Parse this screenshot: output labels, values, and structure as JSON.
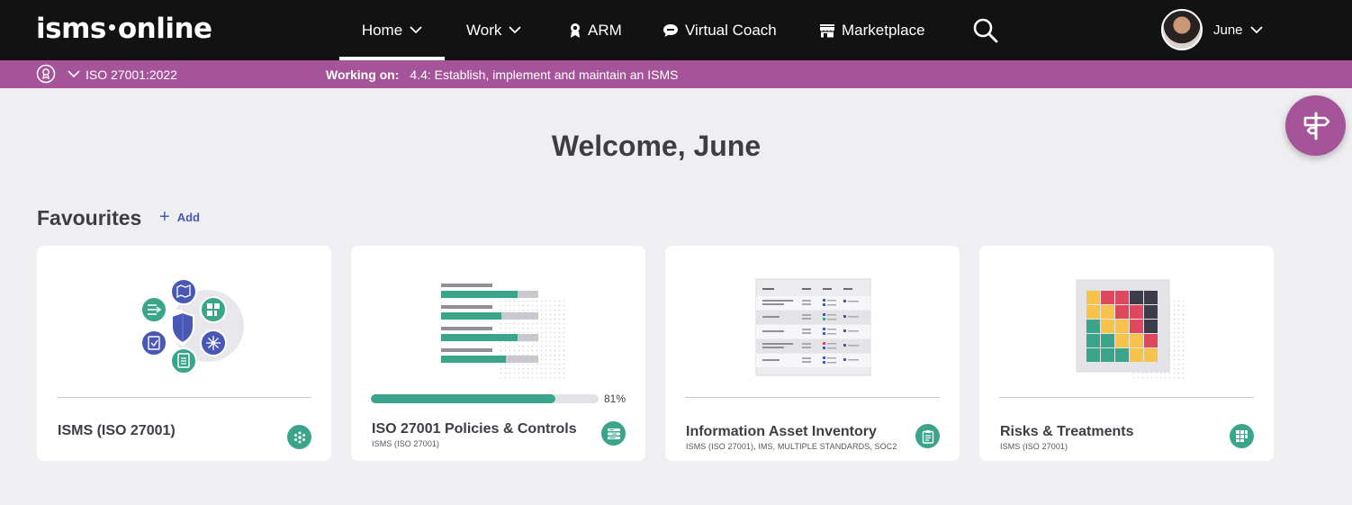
{
  "brand": {
    "logo_left": "isms",
    "logo_right": "online"
  },
  "nav": {
    "home": "Home",
    "work": "Work",
    "arm": "ARM",
    "coach": "Virtual Coach",
    "marketplace": "Marketplace"
  },
  "user": {
    "name": "June"
  },
  "context": {
    "standard": "ISO 27001:2022",
    "working_label": "Working on:",
    "working_value": "4.4: Establish, implement and maintain an ISMS"
  },
  "welcome": "Welcome, June",
  "favourites": {
    "title": "Favourites",
    "add_label": "Add",
    "cards": [
      {
        "title": "ISMS (ISO 27001)",
        "subtitle": "",
        "icon": "hub-icon"
      },
      {
        "title": "ISO 27001 Policies & Controls",
        "subtitle": "ISMS (ISO 27001)",
        "progress": 81,
        "progress_label": "81%",
        "icon": "list-icon"
      },
      {
        "title": "Information Asset Inventory",
        "subtitle": "ISMS (ISO 27001), IMS, MULTIPLE STANDARDS, SOC2",
        "icon": "clipboard-icon"
      },
      {
        "title": "Risks & Treatments",
        "subtitle": "ISMS (ISO 27001)",
        "icon": "grid-icon"
      }
    ]
  },
  "colors": {
    "topbar": "#121212",
    "accent": "#a5549a",
    "green": "#3aa58a",
    "blue": "#4a58b5",
    "background": "#efeff1"
  }
}
